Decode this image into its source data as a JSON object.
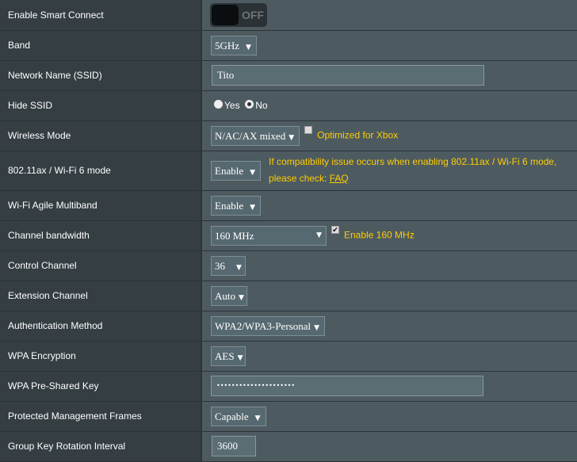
{
  "rows": {
    "smart_connect": {
      "label": "Enable Smart Connect",
      "toggle": "OFF"
    },
    "band": {
      "label": "Band",
      "value": "5GHz"
    },
    "ssid": {
      "label": "Network Name (SSID)",
      "value": "Tito"
    },
    "hide_ssid": {
      "label": "Hide SSID",
      "yes": "Yes",
      "no": "No",
      "selected": "No"
    },
    "wireless_mode": {
      "label": "Wireless Mode",
      "value": "N/AC/AX mixed",
      "checkbox_label": "Optimized for Xbox",
      "checked": false
    },
    "ax_mode": {
      "label": "802.11ax / Wi-Fi 6 mode",
      "value": "Enable",
      "note": "If compatibility issue occurs when enabling 802.11ax / Wi-Fi 6 mode,",
      "note2": "please check: ",
      "link": "FAQ"
    },
    "agile": {
      "label": "Wi-Fi Agile Multiband",
      "value": "Enable"
    },
    "bandwidth": {
      "label": "Channel bandwidth",
      "value": "160 MHz",
      "checkbox_label": "Enable 160 MHz",
      "checked": true
    },
    "control_channel": {
      "label": "Control Channel",
      "value": "36"
    },
    "extension_channel": {
      "label": "Extension Channel",
      "value": "Auto"
    },
    "auth": {
      "label": "Authentication Method",
      "value": "WPA2/WPA3-Personal"
    },
    "encryption": {
      "label": "WPA Encryption",
      "value": "AES"
    },
    "psk": {
      "label": "WPA Pre-Shared Key",
      "value": "•••••••••••••••••••••"
    },
    "pmf": {
      "label": "Protected Management Frames",
      "value": "Capable"
    },
    "gk_rotation": {
      "label": "Group Key Rotation Interval",
      "value": "3600"
    }
  },
  "colors": {
    "label_bg": "#343e43",
    "value_bg": "#4d5b61",
    "accent": "#ffcc00"
  }
}
